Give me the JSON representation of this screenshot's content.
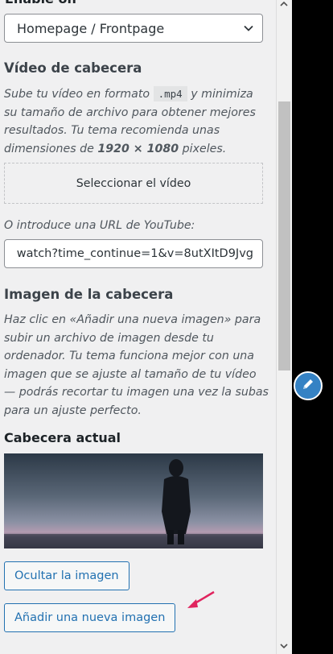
{
  "panel": {
    "enable_on_label": "Enable on",
    "enable_on_value": "Homepage / Frontpage",
    "video": {
      "title": "Vídeo de cabecera",
      "desc_part1": "Sube tu vídeo en formato",
      "desc_code": ".mp4",
      "desc_part2": "y minimiza su tamaño de archivo para obtener mejores resultados. Tu tema recomienda unas dimensiones de",
      "desc_dims": "1920 × 1080",
      "desc_part3": "pixeles.",
      "select_button": "Seleccionar el vídeo",
      "youtube_label": "O introduce una URL de YouTube:",
      "youtube_value": "watch?time_continue=1&v=8utXItD9Jvg"
    },
    "image": {
      "title": "Imagen de la cabecera",
      "description": "Haz clic en «Añadir una nueva imagen» para subir un archivo de imagen desde tu ordenador. Tu tema funciona mejor con una imagen que se ajuste al tamaño de tu vídeo — podrás recortar tu imagen una vez la subas para un ajuste perfecto.",
      "current_label": "Cabecera actual",
      "hide_button": "Ocultar la imagen",
      "add_button": "Añadir una nueva imagen"
    }
  },
  "icons": {
    "select_chevron": "chevron-down-icon",
    "edit": "pencil-icon",
    "annotation": "arrow-icon"
  },
  "colors": {
    "accent": "#2271b1",
    "fab": "#3582c4",
    "annotation_arrow": "#e0245e"
  }
}
